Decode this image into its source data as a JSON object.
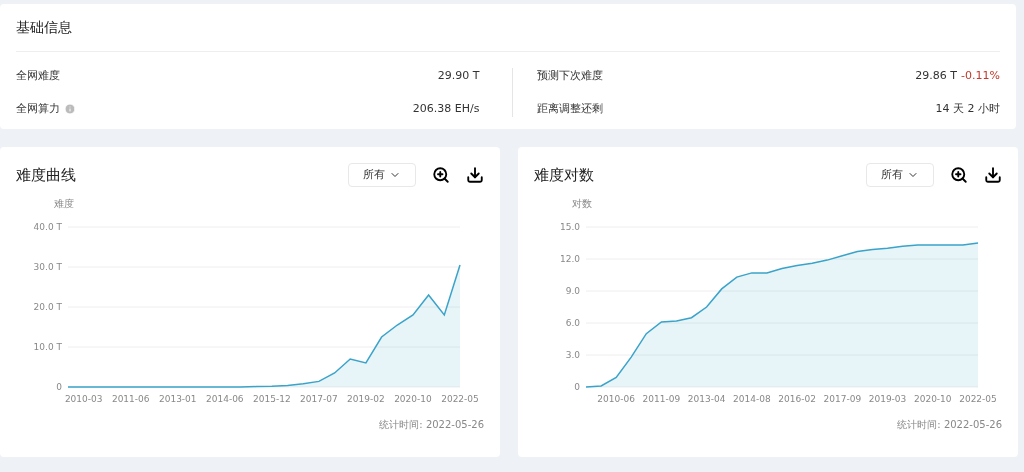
{
  "basic_info": {
    "title": "基础信息",
    "left": [
      {
        "label": "全网难度",
        "value": "29.90 T",
        "info_icon": false
      },
      {
        "label": "全网算力",
        "value": "206.38 EH/s",
        "info_icon": true
      }
    ],
    "right": [
      {
        "label": "预测下次难度",
        "value": "29.86 T",
        "change": "-0.11%"
      },
      {
        "label": "距离调整还剩",
        "value": "14 天 2 小时"
      }
    ]
  },
  "charts": [
    {
      "title": "难度曲线",
      "range": "所有",
      "footer": "统计时间: 2022-05-26",
      "chart_data": {
        "type": "area",
        "grid": true,
        "ylabel": "难度",
        "ylim": [
          0,
          40
        ],
        "yticks": [
          {
            "value": 0,
            "label": "0"
          },
          {
            "value": 10,
            "label": "10.0 T"
          },
          {
            "value": 20,
            "label": "20.0 T"
          },
          {
            "value": 30,
            "label": "30.0 T"
          },
          {
            "value": 40,
            "label": "40.0 T"
          }
        ],
        "categories": [
          null,
          "2010-03",
          null,
          null,
          "2011-06",
          null,
          null,
          "2013-01",
          null,
          null,
          "2014-06",
          null,
          null,
          "2015-12",
          null,
          null,
          "2017-07",
          null,
          null,
          "2019-02",
          null,
          null,
          "2020-10",
          null,
          null,
          "2022-05"
        ],
        "series": [
          {
            "color": "#3aa3c9",
            "values": [
              0,
              0,
              0,
              0,
              0,
              0,
              0,
              0,
              0,
              0,
              0,
              0,
              0.1,
              0.2,
              0.4,
              0.8,
              1.4,
              3.5,
              7,
              6,
              12.5,
              15.5,
              18,
              23,
              18,
              30.5
            ]
          }
        ]
      }
    },
    {
      "title": "难度对数",
      "range": "所有",
      "footer": "统计时间: 2022-05-26",
      "chart_data": {
        "type": "area",
        "grid": true,
        "ylabel": "对数",
        "ylim": [
          0,
          15
        ],
        "yticks": [
          {
            "value": 0,
            "label": "0"
          },
          {
            "value": 3,
            "label": "3.0"
          },
          {
            "value": 6,
            "label": "6.0"
          },
          {
            "value": 9,
            "label": "9.0"
          },
          {
            "value": 12,
            "label": "12.0"
          },
          {
            "value": 15,
            "label": "15.0"
          }
        ],
        "categories": [
          null,
          null,
          "2010-06",
          null,
          null,
          "2011-09",
          null,
          null,
          "2013-04",
          null,
          null,
          "2014-08",
          null,
          null,
          "2016-02",
          null,
          null,
          "2017-09",
          null,
          null,
          "2019-03",
          null,
          null,
          "2020-10",
          null,
          null,
          "2022-05"
        ],
        "series": [
          {
            "color": "#3aa3c9",
            "values": [
              0,
              0.1,
              0.9,
              2.8,
              5,
              6.1,
              6.2,
              6.5,
              7.5,
              9.2,
              10.3,
              10.7,
              10.7,
              11.1,
              11.4,
              11.6,
              11.9,
              12.3,
              12.7,
              12.9,
              13,
              13.2,
              13.3,
              13.3,
              13.3,
              13.3,
              13.5
            ]
          }
        ]
      }
    }
  ]
}
